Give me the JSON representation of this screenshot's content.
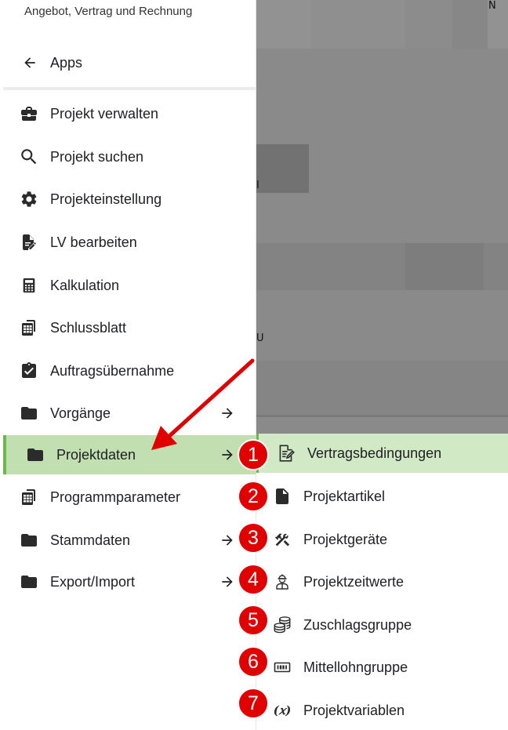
{
  "drawer": {
    "subtitle": "Angebot, Vertrag und Rechnung",
    "apps_label": "Apps",
    "items": [
      {
        "label": "Projekt verwalten",
        "icon": "briefcase-icon"
      },
      {
        "label": "Projekt suchen",
        "icon": "search-icon"
      },
      {
        "label": "Projekteinstellung",
        "icon": "gear-icon"
      },
      {
        "label": "LV bearbeiten",
        "icon": "edit-document-icon"
      },
      {
        "label": "Kalkulation",
        "icon": "calculator-icon"
      },
      {
        "label": "Schlussblatt",
        "icon": "spreadsheet-icon"
      },
      {
        "label": "Auftragsübernahme",
        "icon": "clipboard-check-icon"
      },
      {
        "label": "Vorgänge",
        "icon": "folder-icon",
        "has_submenu": true
      },
      {
        "label": "Projektdaten",
        "icon": "folder-icon",
        "has_submenu": true,
        "active": true
      },
      {
        "label": "Programmparameter",
        "icon": "spreadsheet-icon"
      },
      {
        "label": "Stammdaten",
        "icon": "folder-icon",
        "has_submenu": true
      },
      {
        "label": "Export/Import",
        "icon": "folder-icon",
        "has_submenu": true
      }
    ]
  },
  "submenu": {
    "items": [
      {
        "number": "1",
        "label": "Vertragsbedingungen",
        "icon": "contract-edit-icon",
        "active": true
      },
      {
        "number": "2",
        "label": "Projektartikel",
        "icon": "file-icon"
      },
      {
        "number": "3",
        "label": "Projektgeräte",
        "icon": "tools-icon"
      },
      {
        "number": "4",
        "label": "Projektzeitwerte",
        "icon": "worker-icon"
      },
      {
        "number": "5",
        "label": "Zuschlagsgruppe",
        "icon": "coins-icon"
      },
      {
        "number": "6",
        "label": "Mittellohngruppe",
        "icon": "counter-icon"
      },
      {
        "number": "7",
        "label": "Projektvariablen",
        "icon": "variable-icon"
      }
    ]
  },
  "colors": {
    "active_bg": "#c1dfb0",
    "active_border": "#6cb84a",
    "badge": "#e00000",
    "annotation_arrow": "#e00000",
    "overlay": "#8a8a8a"
  }
}
